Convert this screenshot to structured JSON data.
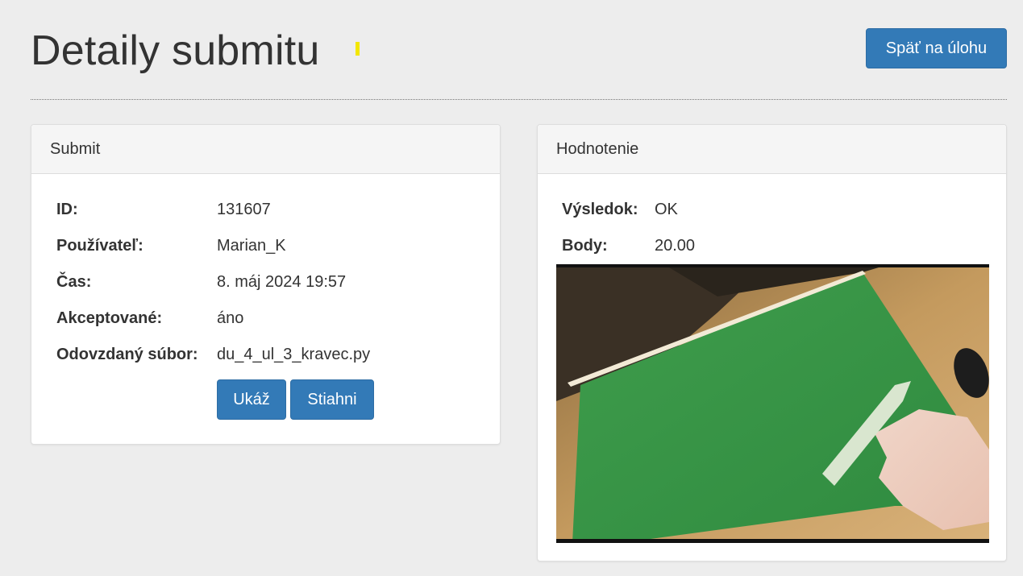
{
  "header": {
    "title": "Detaily submitu",
    "back_label": "Späť na úlohu"
  },
  "submit_panel": {
    "heading": "Submit",
    "fields": [
      {
        "label": "ID:",
        "value": "131607"
      },
      {
        "label": "Používateľ:",
        "value": "Marian_K"
      },
      {
        "label": "Čas:",
        "value": "8. máj 2024 19:57"
      },
      {
        "label": "Akceptované:",
        "value": "áno"
      },
      {
        "label": "Odovzdaný súbor:",
        "value": "du_4_ul_3_kravec.py"
      }
    ],
    "show_label": "Ukáž",
    "download_label": "Stiahni"
  },
  "eval_panel": {
    "heading": "Hodnotenie",
    "fields": [
      {
        "label": "Výsledok:",
        "value": "OK"
      },
      {
        "label": "Body:",
        "value": "20.00"
      }
    ]
  },
  "colors": {
    "primary": "#337ab7",
    "background": "#ededed",
    "mark": "#f3e600",
    "green_sheet": "#3d9e4a"
  }
}
